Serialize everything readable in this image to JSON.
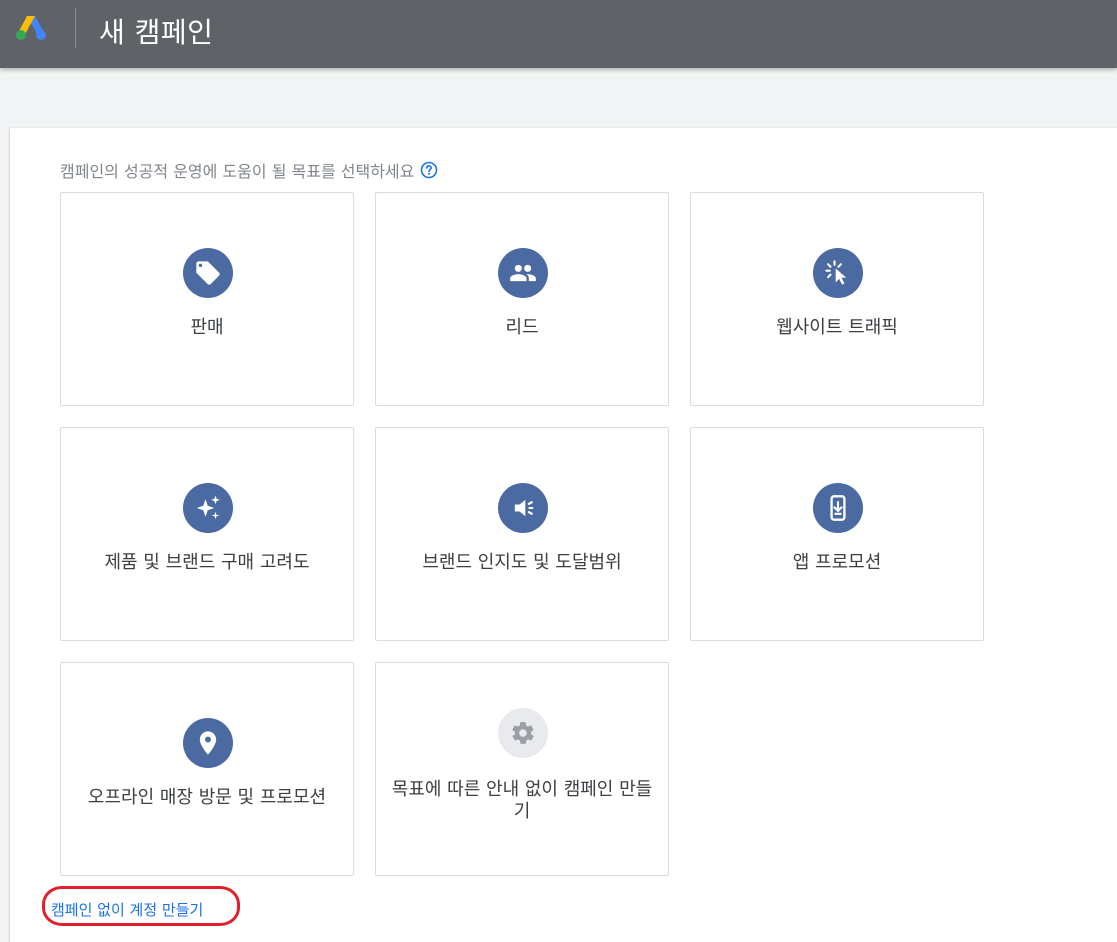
{
  "header": {
    "title": "새 캠페인",
    "logo_colors": {
      "blue": "#4285f4",
      "yellow": "#fbbc04",
      "green": "#34a853"
    }
  },
  "main": {
    "prompt": "캠페인의 성공적 운영에 도움이 될 목표를 선택하세요",
    "goals": [
      {
        "label": "판매",
        "icon": "tag-icon"
      },
      {
        "label": "리드",
        "icon": "people-icon"
      },
      {
        "label": "웹사이트 트래픽",
        "icon": "cursor-click-icon"
      },
      {
        "label": "제품 및 브랜드 구매 고려도",
        "icon": "sparkle-icon"
      },
      {
        "label": "브랜드 인지도 및 도달범위",
        "icon": "speaker-icon"
      },
      {
        "label": "앱 프로모션",
        "icon": "phone-download-icon"
      },
      {
        "label": "오프라인 매장 방문 및 프로모션",
        "icon": "location-pin-icon"
      },
      {
        "label": "목표에 따른 안내 없이 캠페인 만들기",
        "icon": "gear-icon"
      }
    ],
    "create_account_link": "캠페인 없이 계정 만들기"
  },
  "colors": {
    "header_bg": "#5f6368",
    "icon_circle": "#4a6aa1",
    "link": "#1a73e8",
    "highlight": "#e0202a"
  }
}
